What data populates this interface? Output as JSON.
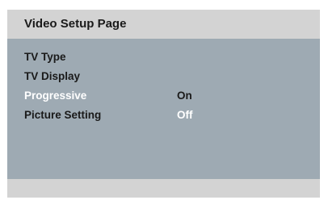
{
  "page": {
    "title": "Video Setup Page"
  },
  "menu": {
    "items": [
      {
        "label": "TV Type",
        "value": ""
      },
      {
        "label": "TV Display",
        "value": ""
      },
      {
        "label": "Progressive",
        "value": "On"
      },
      {
        "label": "Picture Setting",
        "value": "Off"
      }
    ]
  },
  "colors": {
    "panel_background": "#9eaab3",
    "title_background": "#d3d3d3",
    "highlight_text": "#ffffff",
    "normal_text": "#1a1a1a"
  }
}
